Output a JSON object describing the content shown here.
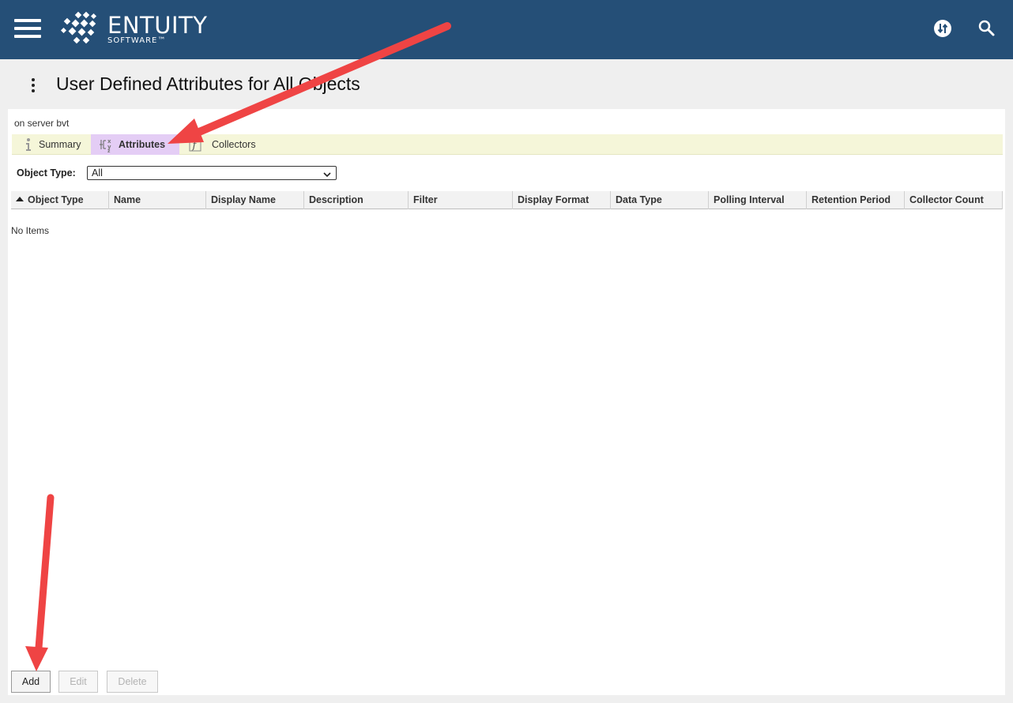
{
  "brand": {
    "name": "ENTUITY",
    "sub": "SOFTWARE™"
  },
  "header": {
    "title": "User Defined Attributes for All Objects"
  },
  "panel": {
    "subtitle": "on server bvt",
    "tabs": [
      {
        "label": "Summary",
        "icon": "info-icon",
        "active": false
      },
      {
        "label": "Attributes",
        "icon": "attributes-icon",
        "active": true
      },
      {
        "label": "Collectors",
        "icon": "function-icon",
        "active": false
      }
    ],
    "filter": {
      "label": "Object Type:",
      "value": "All"
    },
    "columns": [
      "Object Type",
      "Name",
      "Display Name",
      "Description",
      "Filter",
      "Display Format",
      "Data Type",
      "Polling Interval",
      "Retention Period",
      "Collector Count"
    ],
    "sort": {
      "column": "Object Type",
      "direction": "ascending"
    },
    "empty_text": "No Items",
    "buttons": {
      "add": "Add",
      "edit": "Edit",
      "delete": "Delete"
    }
  },
  "colors": {
    "topbar": "#254f77",
    "active_tab": "#e4cdf5",
    "tabbar": "#f5f6d9",
    "annotation_arrow": "#ef4444"
  }
}
